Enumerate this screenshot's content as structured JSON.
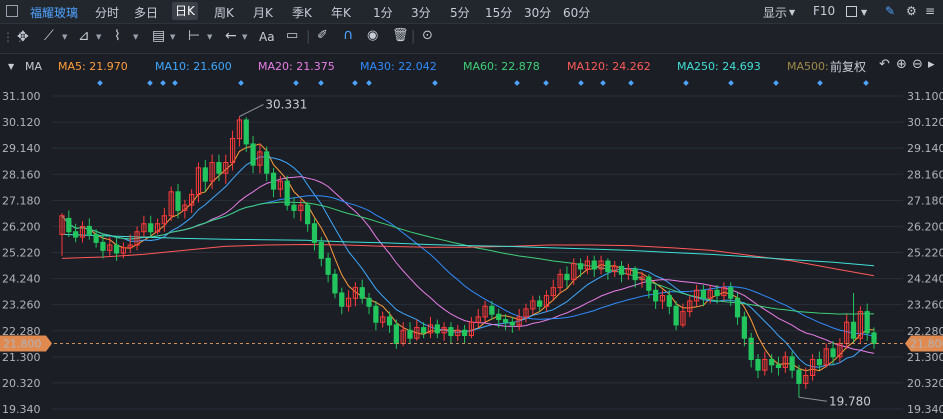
{
  "topbar": {
    "stock_name": "福耀玻璃",
    "periods": [
      "分时",
      "多日",
      "日K",
      "周K",
      "月K",
      "季K",
      "年K",
      "1分",
      "3分",
      "5分",
      "15分",
      "30分",
      "60分"
    ],
    "active_period": "日K",
    "display_label": "显示",
    "f10_label": "F10"
  },
  "toolbar": {
    "text_tool_label": "Aa"
  },
  "ma_bar": {
    "label": "MA",
    "items": [
      {
        "text": "MA5: 21.970",
        "color": "#ff9d3c"
      },
      {
        "text": "MA10: 21.600",
        "color": "#3fa8ff"
      },
      {
        "text": "MA20: 21.375",
        "color": "#e77ee7"
      },
      {
        "text": "MA30: 22.042",
        "color": "#2f8cff"
      },
      {
        "text": "MA60: 22.878",
        "color": "#3fd07a"
      },
      {
        "text": "MA120: 24.262",
        "color": "#ff5a5a"
      },
      {
        "text": "MA250: 24.693",
        "color": "#40e0d8"
      },
      {
        "text": "MA500:",
        "color": "#a08a4a"
      }
    ],
    "adjust_label": "前复权"
  },
  "chart": {
    "y_ticks": [
      "31.100",
      "30.120",
      "29.140",
      "28.160",
      "27.180",
      "26.200",
      "25.220",
      "24.240",
      "23.260",
      "22.280",
      "21.300",
      "20.320",
      "19.340"
    ],
    "current_price": "21.800",
    "high_label": "30.331",
    "low_label": "19.780",
    "up_color": "#ff3b3b",
    "down_color": "#22c55e"
  },
  "chart_data": {
    "type": "candlestick",
    "ylim": [
      19.34,
      31.6
    ],
    "candles": [
      [
        25.9,
        26.6,
        26.7,
        25.1
      ],
      [
        26.5,
        26.0,
        26.8,
        25.8
      ],
      [
        26.0,
        25.8,
        26.3,
        25.6
      ],
      [
        25.8,
        26.2,
        26.4,
        25.6
      ],
      [
        26.2,
        25.9,
        26.5,
        25.7
      ],
      [
        25.9,
        25.6,
        26.1,
        25.4
      ],
      [
        25.6,
        25.3,
        25.9,
        25.0
      ],
      [
        25.3,
        25.5,
        25.8,
        25.1
      ],
      [
        25.5,
        25.2,
        25.8,
        24.9
      ],
      [
        25.2,
        25.4,
        25.6,
        25.0
      ],
      [
        25.4,
        25.5,
        25.9,
        25.2
      ],
      [
        25.5,
        26.0,
        26.2,
        25.3
      ],
      [
        26.0,
        26.3,
        26.6,
        25.8
      ],
      [
        26.3,
        26.0,
        26.6,
        25.8
      ],
      [
        26.0,
        26.3,
        26.5,
        25.9
      ],
      [
        26.3,
        26.6,
        26.9,
        26.0
      ],
      [
        26.6,
        27.5,
        27.7,
        26.4
      ],
      [
        27.5,
        26.8,
        27.8,
        26.5
      ],
      [
        26.8,
        27.0,
        27.2,
        26.5
      ],
      [
        27.0,
        27.4,
        27.6,
        26.7
      ],
      [
        27.4,
        28.4,
        28.6,
        27.1
      ],
      [
        28.4,
        27.9,
        28.7,
        27.5
      ],
      [
        27.9,
        28.6,
        28.9,
        27.6
      ],
      [
        28.6,
        28.2,
        28.9,
        27.9
      ],
      [
        28.2,
        28.6,
        28.9,
        27.8
      ],
      [
        28.6,
        29.5,
        29.8,
        28.3
      ],
      [
        29.5,
        30.2,
        30.33,
        29.2
      ],
      [
        30.2,
        29.3,
        30.3,
        29.0
      ],
      [
        29.3,
        28.5,
        29.6,
        28.2
      ],
      [
        28.5,
        29.0,
        29.3,
        28.2
      ],
      [
        29.0,
        28.2,
        29.2,
        27.9
      ],
      [
        28.2,
        27.6,
        28.4,
        27.3
      ],
      [
        27.6,
        27.9,
        28.1,
        27.3
      ],
      [
        27.9,
        27.0,
        28.1,
        26.8
      ],
      [
        27.0,
        26.8,
        27.3,
        26.5
      ],
      [
        26.8,
        27.0,
        27.2,
        26.4
      ],
      [
        27.0,
        26.3,
        27.1,
        26.0
      ],
      [
        26.3,
        25.6,
        26.5,
        25.3
      ],
      [
        25.6,
        25.0,
        25.8,
        24.7
      ],
      [
        25.0,
        24.4,
        25.2,
        24.1
      ],
      [
        24.4,
        23.7,
        24.6,
        23.5
      ],
      [
        23.7,
        23.2,
        23.9,
        22.9
      ],
      [
        23.2,
        23.5,
        23.8,
        23.0
      ],
      [
        23.5,
        23.9,
        24.1,
        23.2
      ],
      [
        23.9,
        23.5,
        24.2,
        23.3
      ],
      [
        23.5,
        23.2,
        23.7,
        22.9
      ],
      [
        23.2,
        22.6,
        23.4,
        22.3
      ],
      [
        22.6,
        22.8,
        23.0,
        22.4
      ],
      [
        22.8,
        22.5,
        23.0,
        22.2
      ],
      [
        22.5,
        21.8,
        22.7,
        21.6
      ],
      [
        21.8,
        22.3,
        22.6,
        21.7
      ],
      [
        22.3,
        22.0,
        22.6,
        21.8
      ],
      [
        22.0,
        22.4,
        22.7,
        21.9
      ],
      [
        22.4,
        22.2,
        22.6,
        22.0
      ],
      [
        22.2,
        22.5,
        22.8,
        22.0
      ],
      [
        22.5,
        22.2,
        22.7,
        22.0
      ],
      [
        22.2,
        22.4,
        22.6,
        21.9
      ],
      [
        22.4,
        22.1,
        22.6,
        21.8
      ],
      [
        22.1,
        22.3,
        22.5,
        21.9
      ],
      [
        22.3,
        22.1,
        22.5,
        21.8
      ],
      [
        22.1,
        22.6,
        22.8,
        22.0
      ],
      [
        22.6,
        22.8,
        23.1,
        22.4
      ],
      [
        22.8,
        23.2,
        23.4,
        22.6
      ],
      [
        23.2,
        22.9,
        23.4,
        22.7
      ],
      [
        22.9,
        22.7,
        23.1,
        22.4
      ],
      [
        22.7,
        22.6,
        22.9,
        22.3
      ],
      [
        22.6,
        22.5,
        22.8,
        22.2
      ],
      [
        22.5,
        22.8,
        23.1,
        22.3
      ],
      [
        22.8,
        23.1,
        23.3,
        22.6
      ],
      [
        23.1,
        23.4,
        23.6,
        22.9
      ],
      [
        23.4,
        23.2,
        23.6,
        23.0
      ],
      [
        23.2,
        23.6,
        23.8,
        23.0
      ],
      [
        23.6,
        23.9,
        24.2,
        23.4
      ],
      [
        23.9,
        24.4,
        24.6,
        23.7
      ],
      [
        24.4,
        24.2,
        24.7,
        23.9
      ],
      [
        24.2,
        24.8,
        25.0,
        24.0
      ],
      [
        24.8,
        24.6,
        25.0,
        24.3
      ],
      [
        24.6,
        24.9,
        25.1,
        24.4
      ],
      [
        24.9,
        24.6,
        25.1,
        24.3
      ],
      [
        24.6,
        24.9,
        25.1,
        24.4
      ],
      [
        24.9,
        24.5,
        25.0,
        24.2
      ],
      [
        24.5,
        24.7,
        24.9,
        24.3
      ],
      [
        24.7,
        24.4,
        24.9,
        24.1
      ],
      [
        24.4,
        24.6,
        24.8,
        24.2
      ],
      [
        24.6,
        24.2,
        24.7,
        23.9
      ],
      [
        24.2,
        24.3,
        24.5,
        23.9
      ],
      [
        24.3,
        23.8,
        24.4,
        23.5
      ],
      [
        23.8,
        23.4,
        24.0,
        23.1
      ],
      [
        23.4,
        23.6,
        23.8,
        23.1
      ],
      [
        23.6,
        23.2,
        23.8,
        22.9
      ],
      [
        23.2,
        22.5,
        23.4,
        22.3
      ],
      [
        22.5,
        23.0,
        23.3,
        22.4
      ],
      [
        23.0,
        23.4,
        23.6,
        22.8
      ],
      [
        23.4,
        23.8,
        24.0,
        23.2
      ],
      [
        23.8,
        23.5,
        24.0,
        23.2
      ],
      [
        23.5,
        23.8,
        24.0,
        23.3
      ],
      [
        23.8,
        23.6,
        24.0,
        23.3
      ],
      [
        23.6,
        23.9,
        24.1,
        23.4
      ],
      [
        23.9,
        23.5,
        24.1,
        23.2
      ],
      [
        23.5,
        22.8,
        23.7,
        22.5
      ],
      [
        22.8,
        22.0,
        23.0,
        21.7
      ],
      [
        22.0,
        21.2,
        22.2,
        20.9
      ],
      [
        21.2,
        20.8,
        21.4,
        20.5
      ],
      [
        20.8,
        21.2,
        21.5,
        20.6
      ],
      [
        21.2,
        21.0,
        21.4,
        20.7
      ],
      [
        21.0,
        20.9,
        21.3,
        20.6
      ],
      [
        20.9,
        21.3,
        21.5,
        20.7
      ],
      [
        21.3,
        20.8,
        21.5,
        20.5
      ],
      [
        20.8,
        20.3,
        21.0,
        19.78
      ],
      [
        20.3,
        20.6,
        20.9,
        20.1
      ],
      [
        20.6,
        21.2,
        21.4,
        20.4
      ],
      [
        21.2,
        21.0,
        21.5,
        20.8
      ],
      [
        21.0,
        21.6,
        21.8,
        20.9
      ],
      [
        21.6,
        21.3,
        21.9,
        21.0
      ],
      [
        21.3,
        21.8,
        22.0,
        21.1
      ],
      [
        21.8,
        22.6,
        22.9,
        21.6
      ],
      [
        22.6,
        22.0,
        23.7,
        21.8
      ],
      [
        22.0,
        23.0,
        23.2,
        21.8
      ],
      [
        23.0,
        22.2,
        23.3,
        21.9
      ],
      [
        22.2,
        21.8,
        22.4,
        21.6
      ]
    ]
  }
}
